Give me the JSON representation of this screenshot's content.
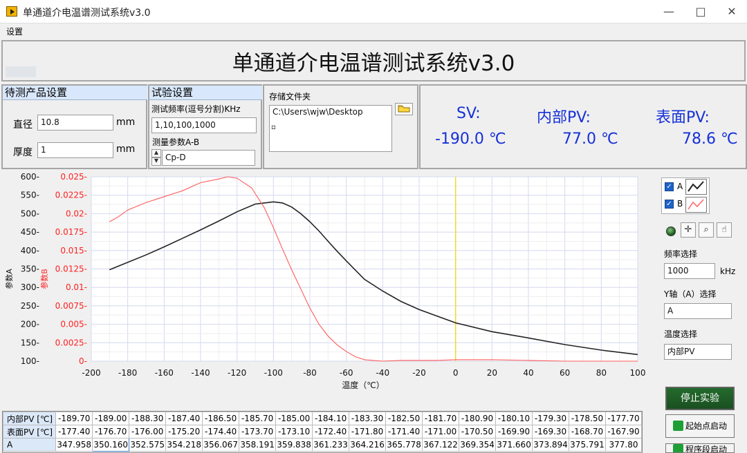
{
  "window": {
    "title": "单通道介电温谱测试系统v3.0",
    "controls": [
      "—",
      "□",
      "✕"
    ]
  },
  "menu": [
    "设置"
  ],
  "header": {
    "title": "单通道介电温谱测试系统v3.0"
  },
  "product": {
    "title": "待测产品设置",
    "diameter_label": "直径",
    "diameter_value": "10.8",
    "diameter_unit": "mm",
    "thickness_label": "厚度",
    "thickness_value": "1",
    "thickness_unit": "mm"
  },
  "test": {
    "title": "试验设置",
    "frequency_label": "测试频率(逗号分割)KHz",
    "frequency_value": "1,10,100,1000",
    "parameter_label": "测量参数A-B",
    "parameter_value": "Cp-D"
  },
  "storage": {
    "label": "存储文件夹",
    "path": "C:\\Users\\wjw\\Desktop"
  },
  "readout": {
    "sv_label": "SV:",
    "sv_value": "-190.0 ℃",
    "inner_label": "内部PV:",
    "inner_value": "77.0 ℃",
    "surface_label": "表面PV:",
    "surface_value": "78.6 ℃"
  },
  "legend": {
    "series_a": "A",
    "series_b": "B"
  },
  "controls": {
    "frequency_select_label": "频率选择",
    "frequency_select_value": "1000",
    "frequency_unit": "kHz",
    "y_axis_label": "Y轴（A）选择",
    "y_axis_value": "A",
    "temperature_label": "温度选择",
    "temperature_value": "内部PV",
    "stop_button": "停止实验",
    "start_point_button": "起始点启动",
    "program_start_button": "程序段启动"
  },
  "chart_data": {
    "type": "line",
    "xlabel": "温度（℃）",
    "ylabel_left": "参数A",
    "ylabel_right": "参数B",
    "x_ticks": [
      -200,
      -180,
      -160,
      -140,
      -120,
      -100,
      -80,
      -60,
      -40,
      -20,
      0,
      20,
      40,
      60,
      80,
      100
    ],
    "y_left_ticks": [
      100,
      150,
      200,
      250,
      300,
      350,
      400,
      450,
      500,
      550,
      600
    ],
    "y_right_ticks": [
      0,
      0.0025,
      0.005,
      0.0075,
      0.01,
      0.0125,
      0.015,
      0.0175,
      0.02,
      0.0225,
      0.025
    ],
    "y_right_tick_labels": [
      "0",
      "0.0025",
      "0.005",
      "0.0075",
      "0.01",
      "0.0125",
      "0.015",
      "0.0175",
      "0.02",
      "0.0225",
      "0.025"
    ],
    "xlim": [
      -200,
      100
    ],
    "ylim_left": [
      100,
      600
    ],
    "ylim_right": [
      0,
      0.025
    ],
    "grid": true,
    "marker_x": 0,
    "series": [
      {
        "name": "A",
        "axis": "left",
        "color": "#222222",
        "points": [
          [
            -190,
            348
          ],
          [
            -180,
            368
          ],
          [
            -170,
            388
          ],
          [
            -160,
            410
          ],
          [
            -150,
            433
          ],
          [
            -140,
            456
          ],
          [
            -130,
            480
          ],
          [
            -120,
            505
          ],
          [
            -110,
            526
          ],
          [
            -100,
            532
          ],
          [
            -95,
            529
          ],
          [
            -90,
            518
          ],
          [
            -85,
            500
          ],
          [
            -80,
            478
          ],
          [
            -75,
            453
          ],
          [
            -70,
            425
          ],
          [
            -65,
            398
          ],
          [
            -60,
            372
          ],
          [
            -50,
            322
          ],
          [
            -40,
            290
          ],
          [
            -30,
            262
          ],
          [
            -20,
            240
          ],
          [
            -10,
            222
          ],
          [
            0,
            204
          ],
          [
            20,
            180
          ],
          [
            40,
            163
          ],
          [
            60,
            145
          ],
          [
            80,
            130
          ],
          [
            100,
            118
          ]
        ]
      },
      {
        "name": "B",
        "axis": "right",
        "color": "#ff5a5a",
        "points": [
          [
            -190,
            0.0189
          ],
          [
            -185,
            0.0196
          ],
          [
            -180,
            0.0205
          ],
          [
            -170,
            0.0215
          ],
          [
            -160,
            0.0223
          ],
          [
            -150,
            0.0231
          ],
          [
            -140,
            0.0242
          ],
          [
            -130,
            0.0247
          ],
          [
            -125,
            0.025
          ],
          [
            -120,
            0.0248
          ],
          [
            -112,
            0.0235
          ],
          [
            -105,
            0.0208
          ],
          [
            -100,
            0.0181
          ],
          [
            -95,
            0.0152
          ],
          [
            -90,
            0.0124
          ],
          [
            -85,
            0.0098
          ],
          [
            -80,
            0.0072
          ],
          [
            -75,
            0.005
          ],
          [
            -70,
            0.0034
          ],
          [
            -65,
            0.0022
          ],
          [
            -60,
            0.0013
          ],
          [
            -55,
            0.0006
          ],
          [
            -50,
            0.0002
          ],
          [
            -40,
            0
          ],
          [
            -30,
            0.0001
          ],
          [
            -10,
            0.0001
          ],
          [
            0,
            0.0002
          ],
          [
            20,
            0.0002
          ],
          [
            40,
            0.0001
          ],
          [
            60,
            0
          ],
          [
            80,
            0
          ],
          [
            100,
            0
          ]
        ]
      }
    ]
  },
  "table": {
    "rows": [
      {
        "label": "内部PV [℃]",
        "values": [
          "-189.70",
          "-189.00",
          "-188.30",
          "-187.40",
          "-186.50",
          "-185.70",
          "-185.00",
          "-184.10",
          "-183.30",
          "-182.50",
          "-181.70",
          "-180.90",
          "-180.10",
          "-179.30",
          "-178.50",
          "-177.70"
        ]
      },
      {
        "label": "表面PV [℃]",
        "values": [
          "-177.40",
          "-176.70",
          "-176.00",
          "-175.20",
          "-174.40",
          "-173.70",
          "-173.10",
          "-172.40",
          "-171.80",
          "-171.40",
          "-171.00",
          "-170.50",
          "-169.90",
          "-169.30",
          "-168.70",
          "-167.90"
        ]
      },
      {
        "label": "A",
        "values": [
          "347.958",
          "350.160",
          "352.575",
          "354.218",
          "356.067",
          "358.191",
          "359.838",
          "361.233",
          "364.216",
          "365.778",
          "367.122",
          "369.354",
          "371.660",
          "373.894",
          "375.791",
          "377.80"
        ]
      }
    ]
  },
  "icons": {
    "folder": "folder-icon",
    "crosshair": "crosshair-icon",
    "zoom": "zoom-icon",
    "hand": "hand-icon",
    "green": "green-arrow-icon"
  }
}
